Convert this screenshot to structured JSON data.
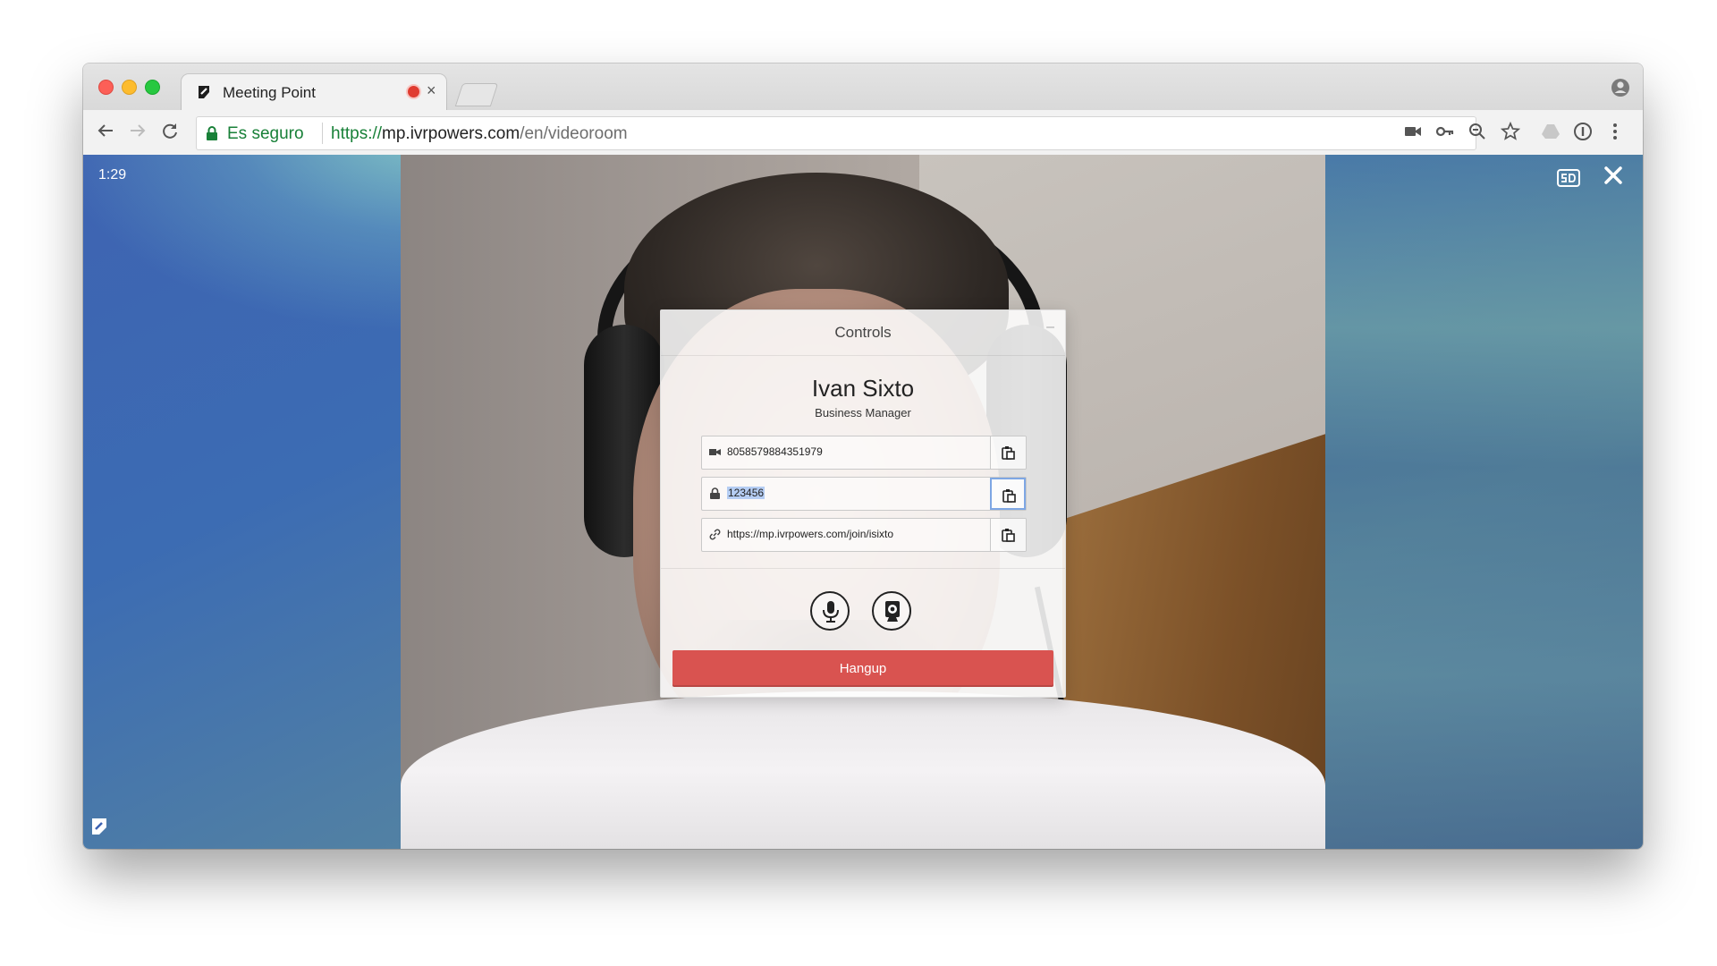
{
  "browser": {
    "tab_title": "Meeting Point",
    "tab_close": "×",
    "secure_label": "Es seguro",
    "url_scheme": "https://",
    "url_host": "mp.ivrpowers.com",
    "url_path": "/en/videoroom"
  },
  "call": {
    "timer": "1:29"
  },
  "controls": {
    "title": "Controls",
    "minimize": "–",
    "user_name": "Ivan Sixto",
    "user_role": "Business Manager",
    "fields": [
      {
        "icon": "video-camera-icon",
        "value": "8058579884351979"
      },
      {
        "icon": "lock-icon",
        "value": "123456"
      },
      {
        "icon": "link-icon",
        "value": "https://mp.ivrpowers.com/join/isixto"
      }
    ],
    "hangup_label": "Hangup"
  },
  "colors": {
    "hangup": "#d95350",
    "secure_green": "#188038",
    "selection": "#b5cdf3"
  }
}
